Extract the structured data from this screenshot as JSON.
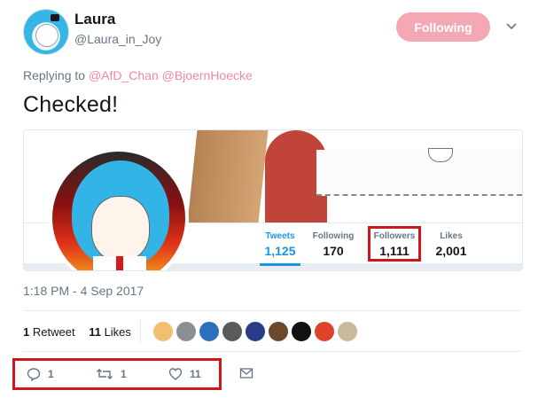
{
  "tweet": {
    "author_name": "Laura",
    "author_handle": "@Laura_in_Joy",
    "follow_button_label": "Following",
    "reply_prefix": "Replying to",
    "reply_mentions": [
      "@AfD_Chan",
      "@BjoernHoecke"
    ],
    "text": "Checked!",
    "timestamp": "1:18 PM - 4 Sep 2017",
    "retweets_count": "1",
    "retweets_label": "Retweet",
    "likes_count": "11",
    "likes_label": "Likes"
  },
  "embedded_profile": {
    "stats": [
      {
        "label": "Tweets",
        "value": "1,125"
      },
      {
        "label": "Following",
        "value": "170"
      },
      {
        "label": "Followers",
        "value": "1,111"
      },
      {
        "label": "Likes",
        "value": "2,001"
      }
    ]
  },
  "actions": {
    "reply_count": "1",
    "retweet_count": "1",
    "like_count": "11"
  },
  "likers": [
    {
      "color": "#f0c070"
    },
    {
      "color": "#8a8f96"
    },
    {
      "color": "#2d6fbf"
    },
    {
      "color": "#5a5a5a"
    },
    {
      "color": "#2a3b8a"
    },
    {
      "color": "#6a4a2a"
    },
    {
      "color": "#111111"
    },
    {
      "color": "#e0412a"
    },
    {
      "color": "#c9b89a"
    }
  ],
  "icons": {
    "chevron": "chevron-down-icon",
    "reply": "reply-icon",
    "retweet": "retweet-icon",
    "like": "heart-icon",
    "dm": "envelope-icon"
  },
  "colors": {
    "accent": "#1b95e0",
    "follow_button": "#f4a8b4",
    "mention": "#f0899b",
    "highlight": "#d0161b"
  }
}
